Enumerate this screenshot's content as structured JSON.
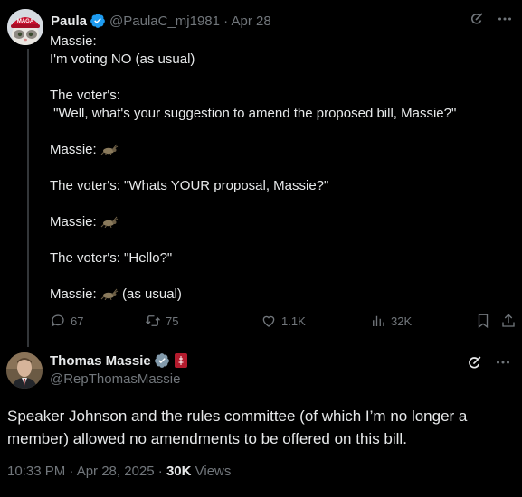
{
  "reply": {
    "author_name": "Paula",
    "handle_line": "@PaulaC_mj1981 · Apr 28",
    "avatar_hat_text": "MAGA",
    "lines": [
      "Massie:",
      "I'm voting NO (as usual)",
      "",
      "The voter's:",
      " \"Well, what's your suggestion to amend the proposed bill, Massie?\"",
      "",
      "Massie: ",
      "",
      "The voter's: \"Whats YOUR proposal, Massie?\"",
      "",
      "Massie: ",
      "",
      "The voter's: \"Hello?\"",
      "",
      "Massie:  (as usual)"
    ],
    "cricket_emoji": "cricket",
    "stats": {
      "replies": "67",
      "reposts": "75",
      "likes": "1.1K",
      "views": "32K"
    }
  },
  "main": {
    "author_name": "Thomas Massie",
    "handle": "@RepThomasMassie",
    "text": "Speaker Johnson and the rules committee (of which I’m no longer a member) allowed no amendments to be offered on this bill.",
    "timestamp": "10:33 PM · Apr 28, 2025 · ",
    "views_count": "30K",
    "views_label": " Views"
  },
  "colors": {
    "background": "#000000",
    "text": "#e7e9ea",
    "muted": "#71767b",
    "verified": "#1d9bf0",
    "divider": "#2f3336"
  }
}
